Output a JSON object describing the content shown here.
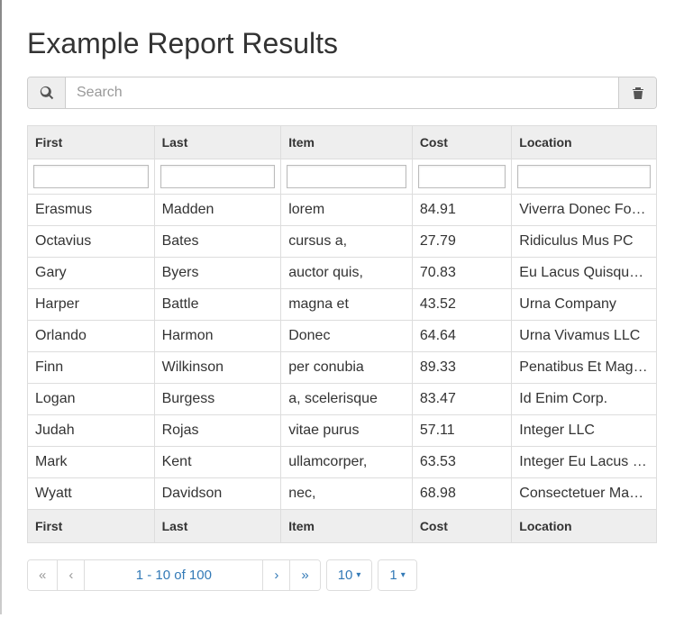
{
  "title": "Example Report Results",
  "search": {
    "placeholder": "Search"
  },
  "columns": [
    "First",
    "Last",
    "Item",
    "Cost",
    "Location"
  ],
  "rows": [
    {
      "first": "Erasmus",
      "last": "Madden",
      "item": "lorem",
      "cost": "84.91",
      "location": "Viverra Donec Foundation"
    },
    {
      "first": "Octavius",
      "last": "Bates",
      "item": "cursus a,",
      "cost": "27.79",
      "location": "Ridiculus Mus PC"
    },
    {
      "first": "Gary",
      "last": "Byers",
      "item": "auctor quis,",
      "cost": "70.83",
      "location": "Eu Lacus Quisque Corp."
    },
    {
      "first": "Harper",
      "last": "Battle",
      "item": "magna et",
      "cost": "43.52",
      "location": "Urna Company"
    },
    {
      "first": "Orlando",
      "last": "Harmon",
      "item": "Donec",
      "cost": "64.64",
      "location": "Urna Vivamus LLC"
    },
    {
      "first": "Finn",
      "last": "Wilkinson",
      "item": "per conubia",
      "cost": "89.33",
      "location": "Penatibus Et Magnis LLC"
    },
    {
      "first": "Logan",
      "last": "Burgess",
      "item": "a, scelerisque",
      "cost": "83.47",
      "location": "Id Enim Corp."
    },
    {
      "first": "Judah",
      "last": "Rojas",
      "item": "vitae purus",
      "cost": "57.11",
      "location": "Integer LLC"
    },
    {
      "first": "Mark",
      "last": "Kent",
      "item": "ullamcorper,",
      "cost": "63.53",
      "location": "Integer Eu Lacus Inc."
    },
    {
      "first": "Wyatt",
      "last": "Davidson",
      "item": "nec,",
      "cost": "68.98",
      "location": "Consectetuer Mauris Corp."
    }
  ],
  "pagination": {
    "first_label": "«",
    "prev_label": "‹",
    "range": "1 - 10 of 100",
    "next_label": "›",
    "last_label": "»",
    "page_size": "10",
    "current_page": "1"
  }
}
